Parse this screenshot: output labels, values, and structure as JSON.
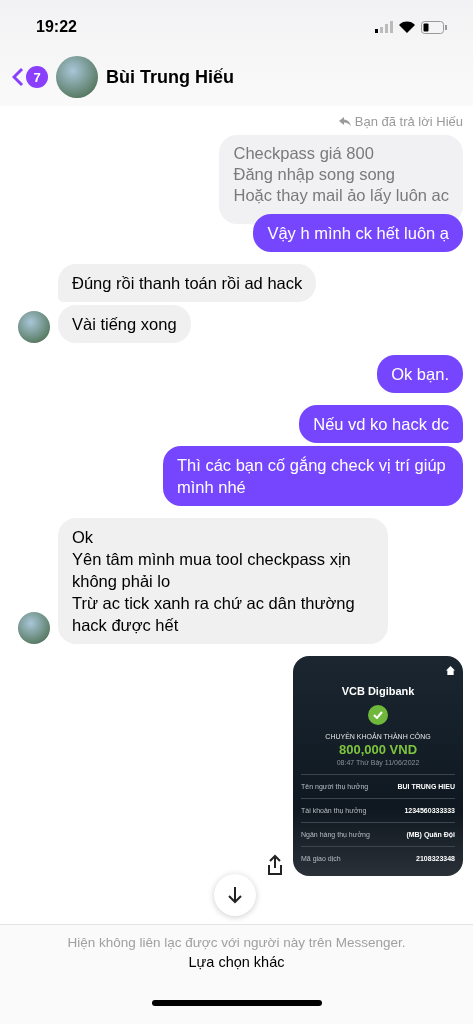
{
  "status_bar": {
    "time": "19:22"
  },
  "header": {
    "unread_count": "7",
    "name": "Bùi Trung Hiếu"
  },
  "messages": [
    {
      "kind": "reply_note",
      "text": "Bạn đã trả lời Hiếu"
    },
    {
      "kind": "quoted",
      "text": "Checkpass giá 800\nĐăng nhập song song\nHoặc thay mail ảo lấy luôn ac"
    },
    {
      "kind": "outgoing",
      "text": "Vậy h mình ck hết luôn ạ",
      "group_end": true
    },
    {
      "kind": "incoming",
      "text": "Đúng rồi thanh toán rồi ad hack",
      "group_end": false
    },
    {
      "kind": "incoming",
      "text": "Vài tiếng xong",
      "group_end": true
    },
    {
      "kind": "outgoing",
      "text": "Ok bạn.",
      "group_end": true
    },
    {
      "kind": "outgoing",
      "text": "Nếu vd ko hack dc",
      "group_end": false
    },
    {
      "kind": "outgoing",
      "text": "Thì các bạn cố gắng check vị trí giúp mình nhé",
      "group_end": true
    },
    {
      "kind": "incoming",
      "text": "Ok\nYên tâm mình mua tool checkpass xịn không phải lo\nTrừ ac tick xanh ra chứ ac dân thường hack được hết",
      "group_end": true
    },
    {
      "kind": "receipt",
      "brand": "VCB Digibank",
      "status": "CHUYỂN KHOẢN THÀNH CÔNG",
      "amount": "800,000 VND",
      "datetime": "08:47 Thứ Bảy 11/06/2022",
      "rows": [
        {
          "label": "Tên người thụ hưởng",
          "value": "BUI TRUNG HIEU"
        },
        {
          "label": "Tài khoản thụ hưởng",
          "value": "1234560333333"
        },
        {
          "label": "Ngân hàng thụ hưởng",
          "value": "(MB) Quân Đội"
        },
        {
          "label": "Mã giao dịch",
          "value": "2108323348"
        }
      ]
    }
  ],
  "footer": {
    "notice": "Hiện không liên lạc được với người này trên Messenger.",
    "action": "Lựa chọn khác"
  }
}
